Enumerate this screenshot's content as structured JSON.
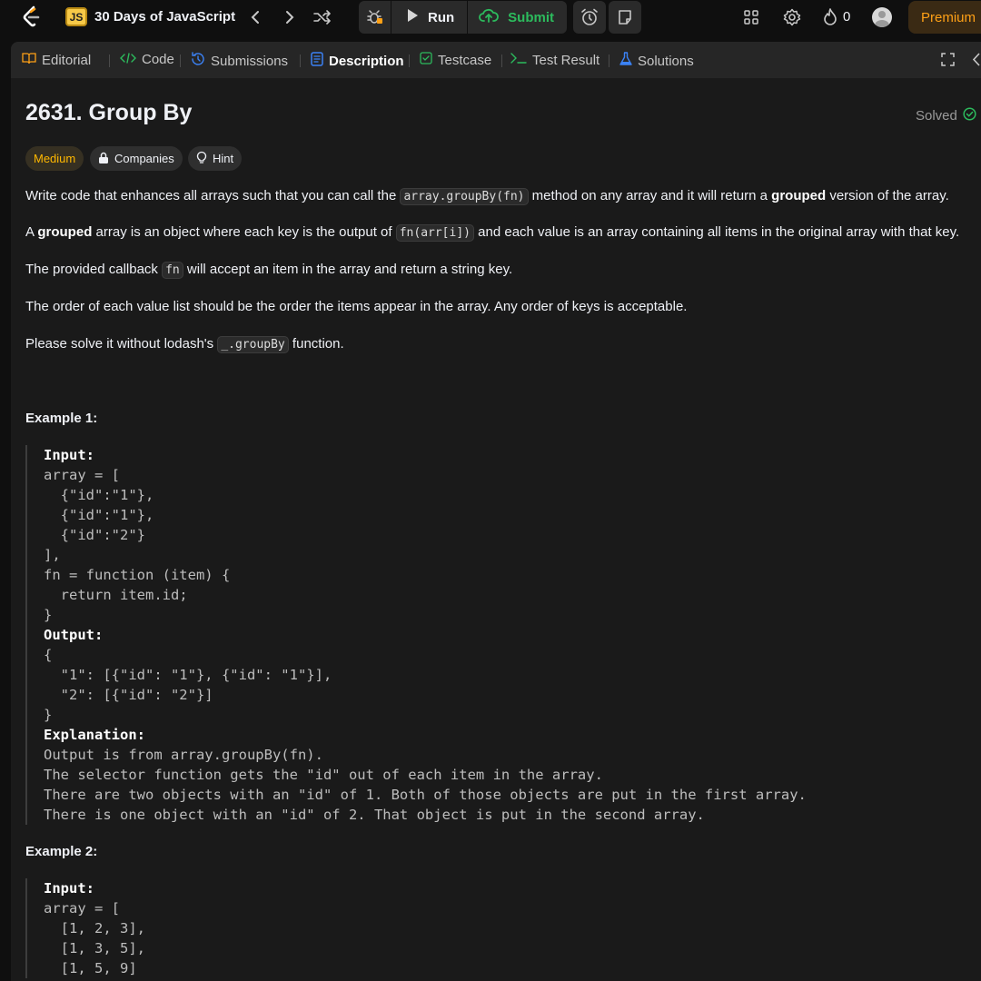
{
  "topnav": {
    "js_badge": "JS",
    "study_title": "30 Days of JavaScript",
    "run_label": "Run",
    "submit_label": "Submit",
    "streak_count": "0",
    "premium_label": "Premium"
  },
  "tabs": [
    {
      "label": "Editorial",
      "icon": "book-icon"
    },
    {
      "label": "Code",
      "icon": "code-icon"
    },
    {
      "label": "Submissions",
      "icon": "history-icon"
    },
    {
      "label": "Description",
      "icon": "description-icon",
      "active": true
    },
    {
      "label": "Testcase",
      "icon": "checkbox-icon"
    },
    {
      "label": "Test Result",
      "icon": "terminal-icon"
    },
    {
      "label": "Solutions",
      "icon": "flask-icon"
    }
  ],
  "problem": {
    "title": "2631. Group By",
    "status": "Solved",
    "difficulty": "Medium",
    "companies_label": "Companies",
    "hint_label": "Hint",
    "desc": {
      "p1_a": "Write code that enhances all arrays such that you can call the ",
      "p1_code": "array.groupBy(fn)",
      "p1_b": " method on any array and it will return a ",
      "p1_bold": "grouped",
      "p1_c": " version of the array.",
      "p2_a": "A ",
      "p2_bold": "grouped",
      "p2_b": " array is an object where each key is the output of ",
      "p2_code": "fn(arr[i])",
      "p2_c": " and each value is an array containing all items in the original array with that key.",
      "p3_a": "The provided callback ",
      "p3_code": "fn",
      "p3_b": " will accept an item in the array and return a string key.",
      "p4": "The order of each value list should be the order the items appear in the array. Any order of keys is acceptable.",
      "p5_a": "Please solve it without lodash's ",
      "p5_code": "_.groupBy",
      "p5_b": " function."
    }
  },
  "examples": [
    {
      "title": "Example 1:",
      "lines": [
        {
          "text": "Input:",
          "label": true
        },
        {
          "text": "array = ["
        },
        {
          "text": "  {\"id\":\"1\"},"
        },
        {
          "text": "  {\"id\":\"1\"},"
        },
        {
          "text": "  {\"id\":\"2\"}"
        },
        {
          "text": "],"
        },
        {
          "text": "fn = function (item) {"
        },
        {
          "text": "  return item.id;"
        },
        {
          "text": "}"
        },
        {
          "text": "Output:",
          "label": true
        },
        {
          "text": "{"
        },
        {
          "text": "  \"1\": [{\"id\": \"1\"}, {\"id\": \"1\"}],"
        },
        {
          "text": "  \"2\": [{\"id\": \"2\"}]"
        },
        {
          "text": "}"
        },
        {
          "text": "Explanation:",
          "label": true
        },
        {
          "text": "Output is from array.groupBy(fn)."
        },
        {
          "text": "The selector function gets the \"id\" out of each item in the array."
        },
        {
          "text": "There are two objects with an \"id\" of 1. Both of those objects are put in the first array."
        },
        {
          "text": "There is one object with an \"id\" of 2. That object is put in the second array."
        }
      ]
    },
    {
      "title": "Example 2:",
      "lines": [
        {
          "text": "Input:",
          "label": true
        },
        {
          "text": "array = ["
        },
        {
          "text": "  [1, 2, 3],"
        },
        {
          "text": "  [1, 3, 5],"
        },
        {
          "text": "  [1, 5, 9]"
        }
      ]
    }
  ],
  "colors": {
    "accent_orange": "#ffa116",
    "submit_green": "#2cbb5d",
    "medium_yellow": "#ffb800",
    "panel_bg": "#1a1a1a"
  }
}
